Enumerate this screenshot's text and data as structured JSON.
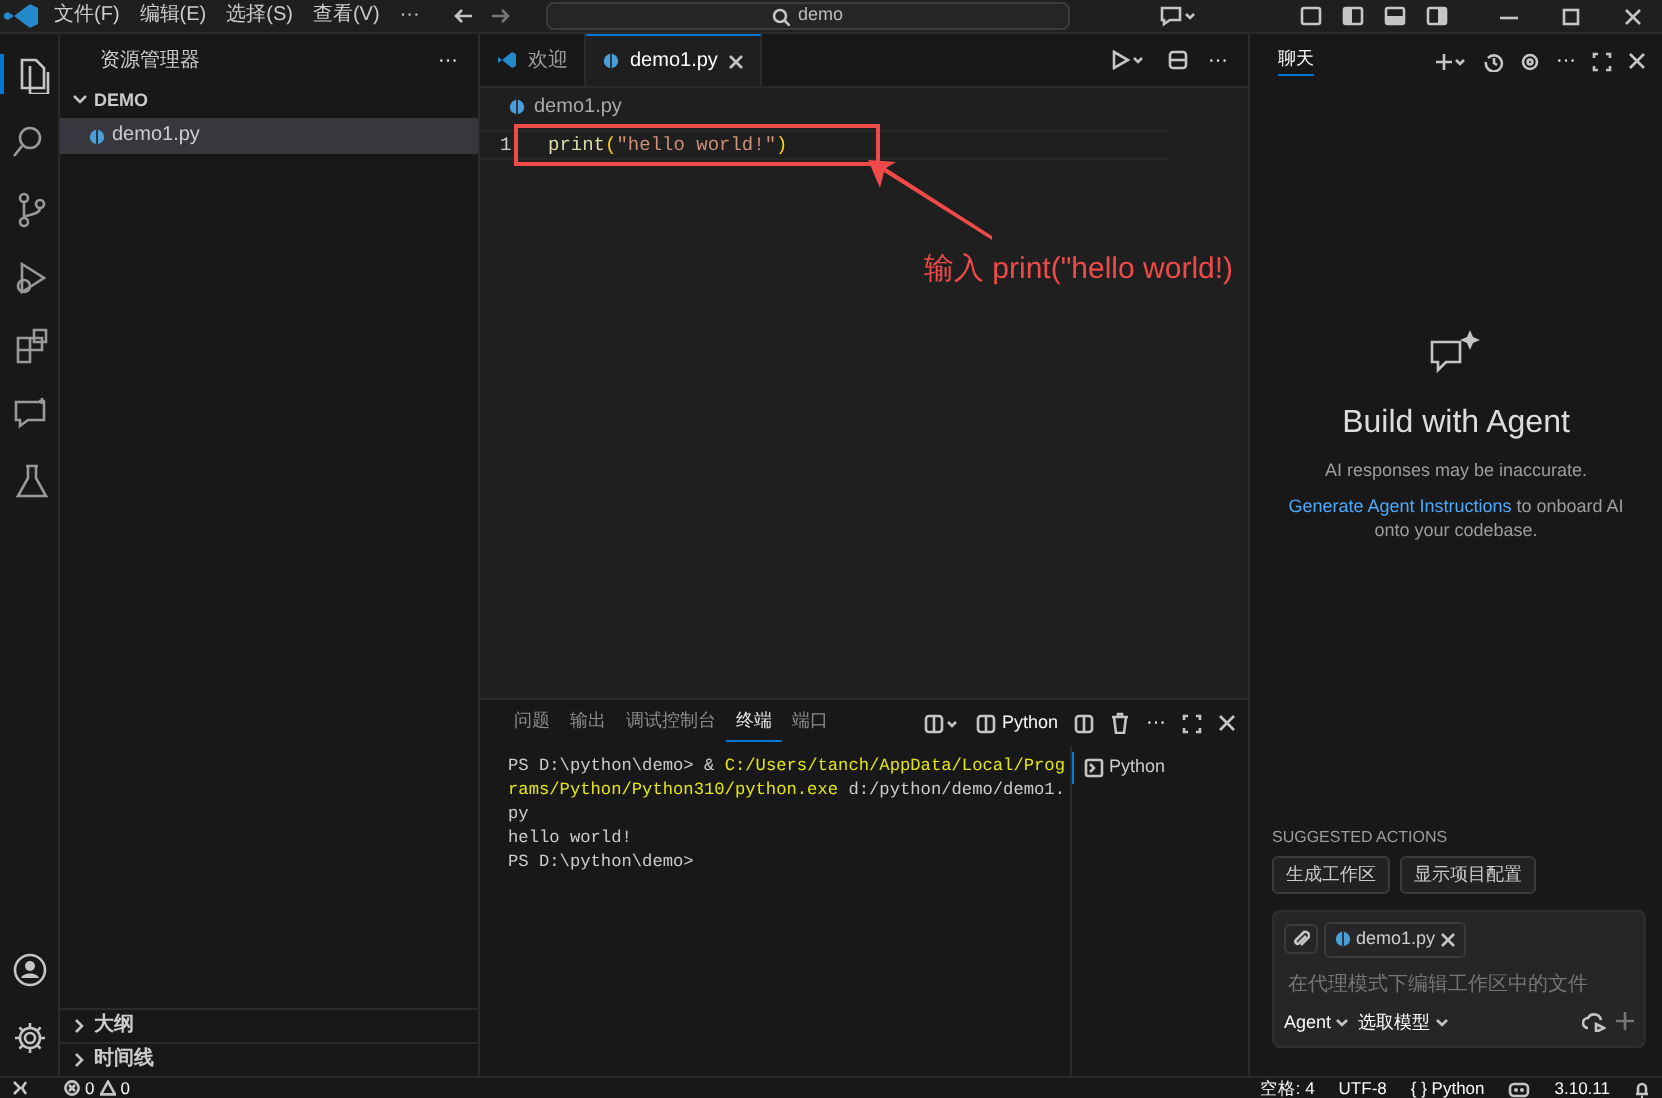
{
  "title_bar": {
    "menus": [
      "文件(F)",
      "编辑(E)",
      "选择(S)",
      "查看(V)",
      "···"
    ],
    "search": "demo"
  },
  "activity_bar": [
    {
      "kind": "files",
      "selected": true
    },
    {
      "kind": "search",
      "selected": false
    },
    {
      "kind": "branch",
      "selected": false
    },
    {
      "kind": "debug",
      "selected": false
    },
    {
      "kind": "extensions",
      "selected": false
    },
    {
      "kind": "chat",
      "selected": false
    },
    {
      "kind": "flask",
      "selected": false
    }
  ],
  "explorer": {
    "title": "资源管理器",
    "more": "···",
    "folder": {
      "name": "DEMO",
      "expanded": true,
      "children": [
        {
          "name": "demo1.py",
          "selected": true
        }
      ]
    },
    "sections": [
      {
        "name": "大纲",
        "expanded": false
      },
      {
        "name": "时间线",
        "expanded": false
      }
    ]
  },
  "editor": {
    "tabs": [
      {
        "label": "欢迎",
        "kind": "welcome",
        "selected": false
      },
      {
        "label": "demo1.py",
        "kind": "python",
        "selected": true
      }
    ],
    "more": "···",
    "breadcrumb": "demo1.py",
    "lines": [
      {
        "number": "1",
        "tokens": [
          {
            "text": "print",
            "kind": "function"
          },
          {
            "text": "(",
            "kind": "bracket"
          },
          {
            "text": "\"hello world!\"",
            "kind": "string"
          },
          {
            "text": ")",
            "kind": "bracket"
          }
        ]
      }
    ]
  },
  "annotation": {
    "text": "输入 print(\"hello world!)"
  },
  "panel": {
    "tabs": [
      {
        "label": "问题",
        "selected": false
      },
      {
        "label": "输出",
        "selected": false
      },
      {
        "label": "调试控制台",
        "selected": false
      },
      {
        "label": "终端",
        "selected": true
      },
      {
        "label": "端口",
        "selected": false
      }
    ],
    "shell_label": "Python",
    "more": "···",
    "terminal_lines": [
      [
        {
          "text": "PS D:\\python\\demo> & ",
          "kind": "plain"
        },
        {
          "text": "C:/Users/tanch/AppData/Local/Prog",
          "kind": "path"
        }
      ],
      [
        {
          "text": "rams/Python/Python310/python.exe",
          "kind": "path"
        },
        {
          "text": " d:/python/demo/demo1.",
          "kind": "plain"
        }
      ],
      [
        {
          "text": "py",
          "kind": "plain"
        }
      ],
      [
        {
          "text": "hello world!",
          "kind": "plain"
        }
      ],
      [
        {
          "text": "PS D:\\python\\demo>",
          "kind": "plain"
        }
      ]
    ],
    "terminals": [
      {
        "name": "Python",
        "selected": true
      }
    ]
  },
  "chat": {
    "tab": "聊天",
    "more": "···",
    "heading": "Build with Agent",
    "disclaimer": "AI responses may be inaccurate.",
    "link": "Generate Agent Instructions",
    "after_link": " to onboard AI onto your codebase.",
    "suggested_title": "SUGGESTED ACTIONS",
    "suggestions": [
      "生成工作区",
      "显示项目配置"
    ],
    "attachment": "demo1.py",
    "placeholder": "在代理模式下编辑工作区中的文件",
    "mode": "Agent",
    "model": "选取模型"
  },
  "status_bar": {
    "errors": "0",
    "warnings": "0",
    "items": [
      "空格: 4",
      "UTF-8",
      "{ } Python"
    ],
    "version": "3.10.11"
  }
}
